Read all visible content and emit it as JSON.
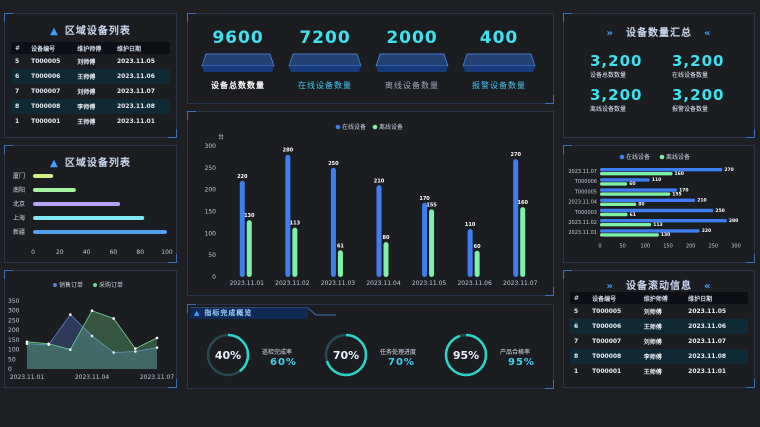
{
  "colors": {
    "online": "#3f7ef0",
    "offline": "#7ff0a6",
    "accent": "#3fe0f0",
    "panel_border": "#2a3447"
  },
  "region_table": {
    "title": "区域设备列表",
    "headers": [
      "#",
      "设备编号",
      "维护师傅",
      "维护日期"
    ],
    "rows": [
      [
        "5",
        "T000005",
        "刘师傅",
        "2023.11.05"
      ],
      [
        "6",
        "T000006",
        "王师傅",
        "2023.11.06"
      ],
      [
        "7",
        "T000007",
        "刘师傅",
        "2023.11.07"
      ],
      [
        "8",
        "T000008",
        "李师傅",
        "2023.11.08"
      ],
      [
        "1",
        "T000001",
        "王师傅",
        "2023.11.01"
      ]
    ]
  },
  "region_bars": {
    "title": "区域设备列表",
    "chart_data": {
      "type": "bar",
      "orientation": "horizontal",
      "categories": [
        "厦门",
        "南阳",
        "北京",
        "上海",
        "新疆"
      ],
      "values": [
        15,
        32,
        65,
        83,
        100
      ],
      "bar_colors": [
        "#d3f08a",
        "#a7f2a0",
        "#b6a4f0",
        "#7fe6f2",
        "#4fa0f0"
      ],
      "xlim": [
        0,
        100
      ],
      "xticks": [
        "0",
        "20",
        "40",
        "60",
        "80",
        "100"
      ]
    }
  },
  "orders": {
    "chart_data": {
      "type": "area",
      "series": [
        {
          "name": "销售订单",
          "color": "#5a7fd8",
          "values": [
            130,
            125,
            280,
            170,
            85,
            90,
            110
          ]
        },
        {
          "name": "采购订单",
          "color": "#6fd890",
          "values": [
            140,
            130,
            100,
            300,
            260,
            105,
            160
          ]
        }
      ],
      "x_labels": [
        "2023.11.01",
        "2023.11.04",
        "2023.11.07"
      ],
      "yticks": [
        "0",
        "50",
        "100",
        "150",
        "200",
        "250",
        "300",
        "350"
      ],
      "ylim": [
        0,
        350
      ]
    }
  },
  "kpis": [
    {
      "value": "9600",
      "label": "设备总数数量",
      "color": "#ffffff"
    },
    {
      "value": "7200",
      "label": "在线设备数量",
      "color": "#3fc8f0"
    },
    {
      "value": "2000",
      "label": "离线设备数量",
      "color": "#a0a8b8"
    },
    {
      "value": "400",
      "label": "报警设备数量",
      "color": "#3fc8f0"
    }
  ],
  "main_chart": {
    "chart_data": {
      "type": "bar",
      "unit": "台",
      "categories": [
        "2023.11.01",
        "2023.11.02",
        "2023.11.03",
        "2023.11.04",
        "2023.11.05",
        "2023.11.06",
        "2023.11.07"
      ],
      "series": [
        {
          "name": "在线设备",
          "color": "#3f7ef0",
          "values": [
            220,
            280,
            250,
            210,
            170,
            110,
            270
          ]
        },
        {
          "name": "离线设备",
          "color": "#7ff0a6",
          "values": [
            130,
            113,
            61,
            80,
            155,
            60,
            160
          ]
        }
      ],
      "labels_online": [
        "220",
        "280",
        "250",
        "210",
        "170",
        "110",
        "270"
      ],
      "labels_offline": [
        "130",
        "113",
        "61",
        "80",
        "155",
        "60",
        "160"
      ],
      "ylim": [
        0,
        300
      ],
      "yticks": [
        "0",
        "50",
        "100",
        "150",
        "200",
        "250",
        "300"
      ]
    }
  },
  "completion": {
    "title": "指标完成概览",
    "items": [
      {
        "pct": "40%",
        "label": "巡检完成率",
        "value": "60%",
        "fraction": 0.4
      },
      {
        "pct": "70%",
        "label": "任务处理进度",
        "value": "70%",
        "fraction": 0.7
      },
      {
        "pct": "95%",
        "label": "产品合格率",
        "value": "95%",
        "fraction": 0.95
      }
    ]
  },
  "summary": {
    "title": "设备数量汇总",
    "items": [
      {
        "value": "3,200",
        "label": "设备总数数量"
      },
      {
        "value": "3,200",
        "label": "在线设备数量"
      },
      {
        "value": "3,200",
        "label": "离线设备数量"
      },
      {
        "value": "3,200",
        "label": "报警设备数量"
      }
    ]
  },
  "hbar2": {
    "chart_data": {
      "type": "bar",
      "orientation": "horizontal",
      "categories": [
        "2023.11.07",
        "T000006",
        "T000005",
        "2023.11.04",
        "T000003",
        "2023.11.02",
        "2023.11.01"
      ],
      "series": [
        {
          "name": "在线设备",
          "color": "#3f7ef0",
          "values": [
            270,
            110,
            170,
            210,
            250,
            280,
            220
          ]
        },
        {
          "name": "离线设备",
          "color": "#7ff0a6",
          "values": [
            160,
            60,
            155,
            80,
            61,
            113,
            130
          ]
        }
      ],
      "labels_online": [
        "270",
        "110",
        "170",
        "210",
        "250",
        "280",
        "220"
      ],
      "labels_offline": [
        "160",
        "60",
        "155",
        "80",
        "61",
        "113",
        "130"
      ],
      "xlim": [
        0,
        300
      ],
      "xticks": [
        "0",
        "50",
        "100",
        "150",
        "200",
        "250",
        "300"
      ]
    }
  },
  "scroll_table": {
    "title": "设备滚动信息",
    "headers": [
      "#",
      "设备编号",
      "维护师傅",
      "维护日期"
    ],
    "rows": [
      [
        "5",
        "T000005",
        "刘师傅",
        "2023.11.05"
      ],
      [
        "6",
        "T000006",
        "王师傅",
        "2023.11.06"
      ],
      [
        "7",
        "T000007",
        "刘师傅",
        "2023.11.07"
      ],
      [
        "8",
        "T000008",
        "李师傅",
        "2023.11.08"
      ],
      [
        "1",
        "T000001",
        "王师傅",
        "2023.11.01"
      ]
    ]
  }
}
